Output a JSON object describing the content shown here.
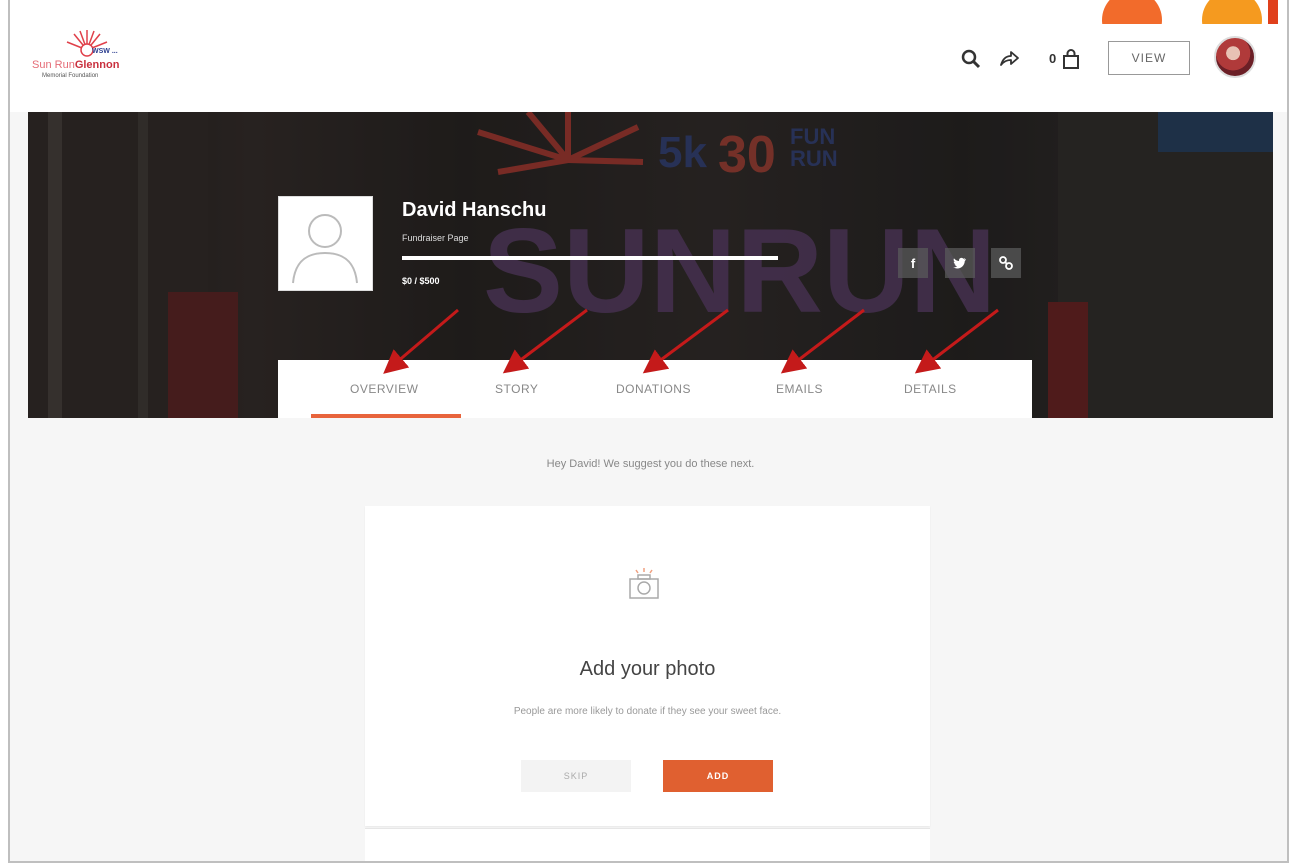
{
  "header": {
    "logo": {
      "line1": "WSW ...",
      "line2a": "Sun Run",
      "line2b": "Glennon",
      "line3": "Memorial Foundation"
    },
    "cart_count": "0",
    "view_label": "VIEW"
  },
  "profile": {
    "name": "David Hanschu",
    "subtitle": "Fundraiser Page",
    "amount": "$0 / $500",
    "progress_fraction": 0
  },
  "share": {
    "facebook": "f",
    "twitter": "twitter-bird-icon",
    "link": "link-icon"
  },
  "tabs": [
    {
      "label": "OVERVIEW",
      "active": true
    },
    {
      "label": "STORY",
      "active": false
    },
    {
      "label": "DONATIONS",
      "active": false
    },
    {
      "label": "EMAILS",
      "active": false
    },
    {
      "label": "DETAILS",
      "active": false
    }
  ],
  "main": {
    "suggestion": "Hey David! We suggest you do these next.",
    "card": {
      "title": "Add your photo",
      "text": "People are more likely to donate if they see your sweet face.",
      "skip_label": "SKIP",
      "add_label": "ADD"
    }
  },
  "colors": {
    "accent": "#e8643c",
    "annotation_arrow": "#c41a1a"
  }
}
